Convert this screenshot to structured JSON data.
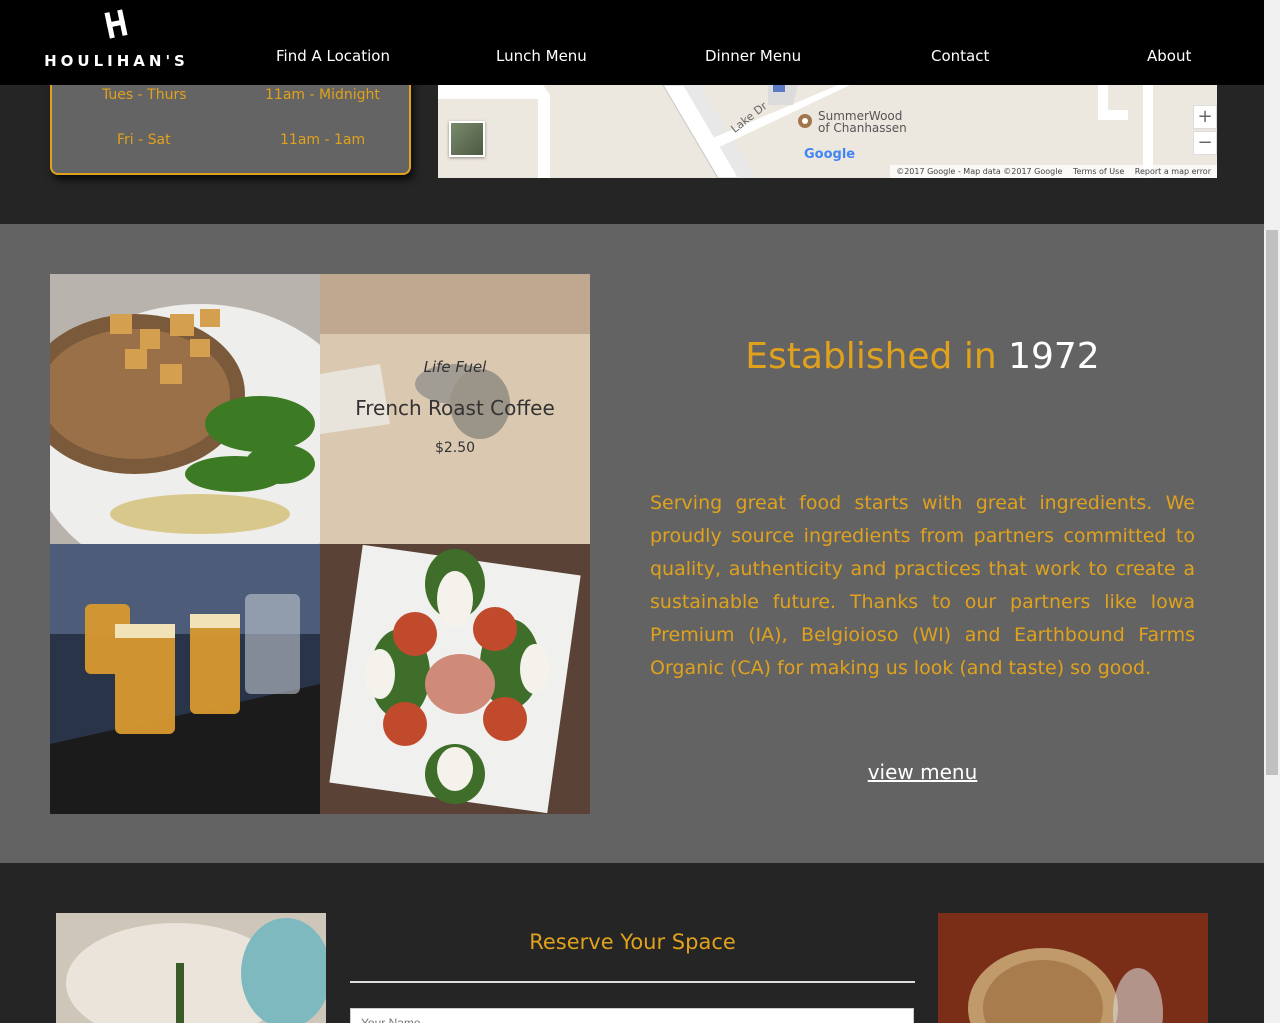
{
  "header": {
    "logo_text": "HOULIHAN'S",
    "nav": [
      "Find A Location",
      "Lunch Menu",
      "Dinner Menu",
      "Contact",
      "About"
    ]
  },
  "hours": [
    {
      "days": "Tues - Thurs",
      "time": "11am - Midnight"
    },
    {
      "days": "Fri - Sat",
      "time": "11am - 1am"
    }
  ],
  "map": {
    "place_line1": "SummerWood",
    "place_line2": "of Chanhassen",
    "road_label": "Lake Dr",
    "brand": "Google",
    "zoom_in": "+",
    "zoom_out": "−",
    "attribution": "©2017 Google - Map data ©2017 Google",
    "terms": "Terms of Use",
    "report": "Report a map error"
  },
  "featured": {
    "tag": "Life Fuel",
    "name": "French Roast Coffee",
    "price": "$2.50"
  },
  "established": {
    "title_prefix": "Established in ",
    "title_year": "1972",
    "body": "Serving great food starts with great ingredients. We proudly source ingredients from partners committed to quality, authenticity and practices that work to create a sustainable future. Thanks to our partners like Iowa Premium (IA), Belgioioso (WI) and Earthbound Farms Organic (CA) for making us look (and taste) so good.",
    "link": "view menu"
  },
  "reserve": {
    "title": "Reserve Your Space",
    "name_placeholder": "Your Name"
  },
  "colors": {
    "accent": "#e0a21d",
    "header_bg": "#000000",
    "section_dark": "#252525",
    "section_gray": "#636363"
  }
}
